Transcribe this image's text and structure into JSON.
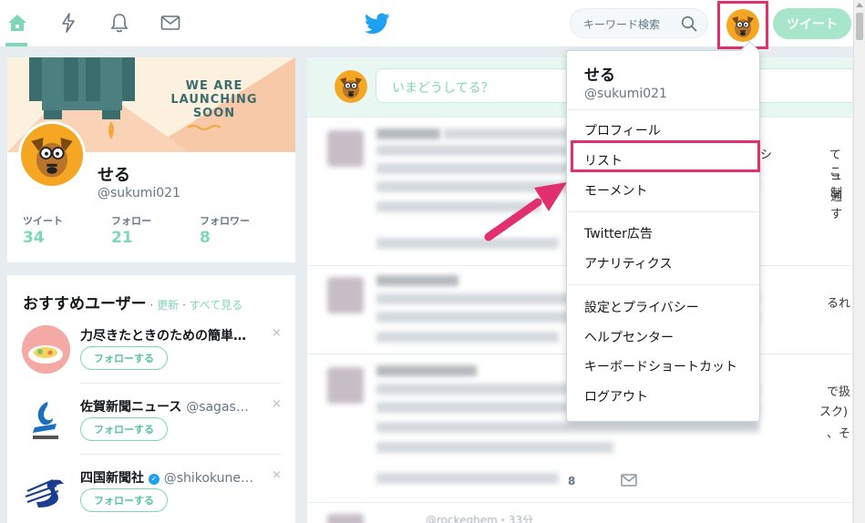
{
  "topbar": {
    "nav": [
      {
        "name": "home",
        "icon": "home-icon",
        "active": true
      },
      {
        "name": "moments",
        "icon": "lightning-icon"
      },
      {
        "name": "notifications",
        "icon": "bell-icon"
      },
      {
        "name": "messages",
        "icon": "envelope-icon"
      }
    ],
    "logo_icon": "twitter-bird-icon",
    "search_placeholder": "キーワード検索",
    "tweet_button": "ツイート",
    "accent": "#7fd7b8",
    "highlight": "#e0306e"
  },
  "profile": {
    "banner_text": [
      "WE ARE",
      "LAUNCHING",
      "SOON"
    ],
    "name": "せる",
    "handle": "@sukumi021",
    "stats": [
      {
        "label": "ツイート",
        "value": "34"
      },
      {
        "label": "フォロー",
        "value": "21"
      },
      {
        "label": "フォロワー",
        "value": "8"
      }
    ]
  },
  "recommend": {
    "title": "おすすめユーザー",
    "sep": " · ",
    "refresh": "更新",
    "view_all": "すべて見る",
    "follow_label": "フォローする",
    "close": "×",
    "users": [
      {
        "name": "力尽きたときのための簡単…",
        "handle": ""
      },
      {
        "name": "佐賀新聞ニュース",
        "handle": "@sagas…"
      },
      {
        "name": "四国新聞社",
        "handle": "@shikokune…",
        "verified": true
      }
    ]
  },
  "timeline": {
    "compose_placeholder": "いまどうしてる？",
    "visible_fragments": {
      "count": "8",
      "t1_right": [
        "シ",
        "てこ",
        "ュ制",
        "通す"
      ],
      "t2_right": [
        "るれ"
      ],
      "t3_right": [
        "で扱",
        "スク)",
        "、そ"
      ],
      "t4_meta": "@rockeghem・33分"
    }
  },
  "menu": {
    "name": "せる",
    "handle": "@sukumi021",
    "groups": [
      [
        "プロフィール",
        "リスト",
        "モーメント"
      ],
      [
        "Twitter広告",
        "アナリティクス"
      ],
      [
        "設定とプライバシー",
        "ヘルプセンター",
        "キーボードショートカット",
        "ログアウト"
      ]
    ],
    "highlighted_item": "リスト"
  }
}
